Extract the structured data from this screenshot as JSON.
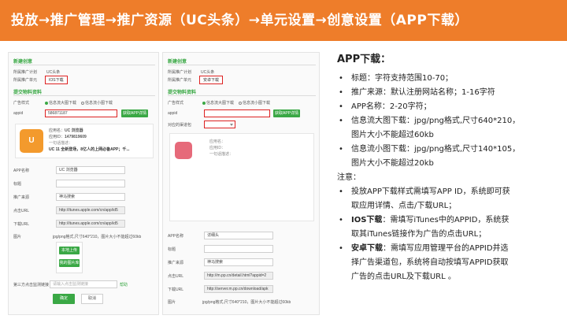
{
  "banner": {
    "title": "投放→推广管理→推广资源（UC头条）→单元设置→创意设置（APP下载）"
  },
  "left_form": {
    "section_new": "新建创意",
    "plan_label": "所属推广计划",
    "plan_value": "UC头条",
    "unit_label": "所属推广单元",
    "unit_value": "IOS下载",
    "section_material": "提交物料资料",
    "style_label": "广告样式",
    "style_opt_big": "信息流大图下载",
    "style_opt_small": "信息流小图下载",
    "appid_label": "appid",
    "appid_value": "586871187",
    "fetch_button": "获取APP详情",
    "card_name_label": "应用名：",
    "card_name": "UC 浏览器",
    "card_id_label": "应用ID：",
    "card_id": "1479819609",
    "card_desc_label": "一句话描述：",
    "card_desc": "UC 11 全新登场，8亿人的上网必备APP；千...",
    "app_name_label": "APP名称",
    "app_name_value": "UC 浏览器",
    "title_label": "标题",
    "source_label": "推广来源",
    "source_value": "神马搜索",
    "click_url_label": "点击URL",
    "click_url_value": "http://itunes.apple.com/cn/app/id5",
    "download_url_label": "下载URL",
    "download_url_value": "http://itunes.apple.com/cn/app/id5",
    "image_label": "图片",
    "image_hint": "jpg/png格式,尺寸640*210，图片大小不能超过60kb",
    "upload_button": "本地上传",
    "library_button": "我的图片库",
    "monitor_label": "第三方点击监测链接",
    "monitor_placeholder": "请输入点击监测链接",
    "help": "帮助",
    "confirm": "确定",
    "cancel": "取消"
  },
  "right_form": {
    "section_new": "新建创意",
    "plan_label": "所属推广计划",
    "plan_value": "UC头条",
    "unit_label": "所属推广单元",
    "unit_value": "安卓下载",
    "section_material": "提交物料资料",
    "style_label": "广告样式",
    "style_opt_big": "信息流大图下载",
    "style_opt_small": "信息流小图下载",
    "appid_label": "appid",
    "fetch_button": "获取APP详情",
    "channel_label": "对应的渠道包",
    "card_name_label": "应用名：",
    "card_id_label": "应用ID：",
    "card_desc_label": "一句话描述：",
    "app_name_label": "APP名称",
    "app_name_value": "详细头",
    "title_label": "标题",
    "source_label": "推广来源",
    "source_value": "神马搜索",
    "click_url_label": "点击URL",
    "click_url_value": "http://m.pp.cn/detail.html?appid=2",
    "download_url_label": "下载URL",
    "download_url_value": "http://server.m.pp.cn/download/apk",
    "image_label": "图片",
    "image_hint": "jpg/png格式,尺寸640*210，图片大小不能超过60kb",
    "upload_button": "本地上传",
    "library_button": "我的图片库",
    "monitor_label": "第三方点击监测链接",
    "monitor_placeholder": "请输入点击监测链接",
    "help": "帮助",
    "confirm": "确定",
    "cancel": "取消"
  },
  "notes": {
    "title": "APP下载：",
    "items": [
      "标题：字符支持范围10-70；",
      "推广来源：默认注册网站名称；1-16字符",
      "APP名称：2-20字符；",
      "信息流大图下载：jpg/png格式,尺寸640*210，",
      "图片大小不能超过60kb",
      "信息流小图下载：jpg/png格式,尺寸140*105，",
      "图片大小不能超过20kb"
    ],
    "note_label": "注意：",
    "notice_1a": "投放APP下载样式需填写APP ID，系统即可获",
    "notice_1b": "取应用详情、点击/下载URL；",
    "ios_label": "IOS下载",
    "ios_text_a": "：需填写iTunes中的APPID，系统获",
    "ios_text_b": "取其iTunes链接作为广告的点击URL；",
    "android_label": "安卓下载",
    "android_text_a": "：需填写应用管理平台的APPID并选",
    "android_text_b": "择广告渠道包，系统将自动按填写APPID获取",
    "android_text_c": "广告的点击URL及下载URL 。"
  },
  "colors": {
    "banner": "#ee7d2a",
    "accent_green": "#3aa845",
    "highlight_red": "#dd2222"
  }
}
